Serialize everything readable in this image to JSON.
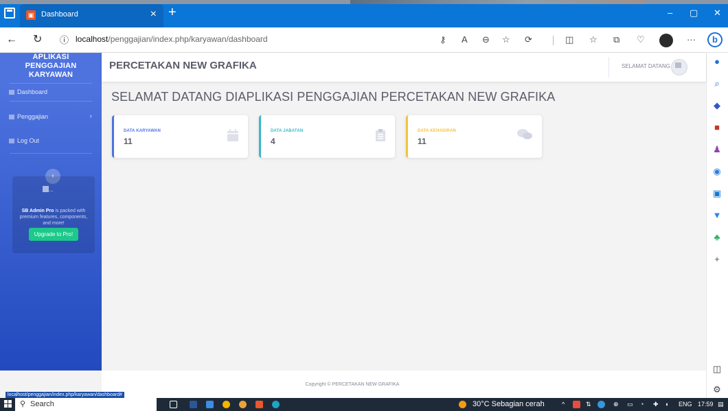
{
  "browser": {
    "tab_title": "Dashboard",
    "url_host": "localhost",
    "url_path": "/penggajian/index.php/karyawan/dashboard",
    "status_url": "localhost/penggajian/index.php/karyawan/dashboard#"
  },
  "sidebar": {
    "brand_line1": "APLIKASI",
    "brand_line2": "PENGGAJIAN",
    "brand_line3": "KARYAWAN",
    "items": [
      {
        "label": "Dashboard"
      },
      {
        "label": "Penggajian"
      },
      {
        "label": "Log Out"
      }
    ],
    "promo": {
      "image_alt": "...",
      "text_bold": "SB Admin Pro",
      "text_rest": " is packed with premium features, components, and more!",
      "button": "Upgrade to Pro!"
    }
  },
  "topbar": {
    "company": "PERCETAKAN NEW GRAFIKA",
    "welcome": "SELAMAT DATANG"
  },
  "main": {
    "heading": "SELAMAT DATANG DIAPLIKASI PENGGAJIAN PERCETAKAN NEW GRAFIKA",
    "cards": [
      {
        "label": "DATA KARYAWAN",
        "value": "11",
        "icon": "calendar-icon",
        "color": "#4e73df"
      },
      {
        "label": "DATA JABATAN",
        "value": "4",
        "icon": "clipboard-icon",
        "color": "#36b9cc"
      },
      {
        "label": "DATA KEHADIRAN",
        "value": "11",
        "icon": "comments-icon",
        "color": "#f6c23e"
      }
    ]
  },
  "footer": {
    "copyright": "Copyright © PERCETAKAN NEW GRAFIKA"
  },
  "taskbar": {
    "search_placeholder": "Search",
    "weather": "30°C  Sebagian cerah",
    "language": "ENG",
    "time": "17:59"
  },
  "colors": {
    "sidebar_top": "#4e73df",
    "sidebar_bottom": "#224abe",
    "browser_bar": "#0a76d8",
    "promo_button": "#1cc88a"
  }
}
